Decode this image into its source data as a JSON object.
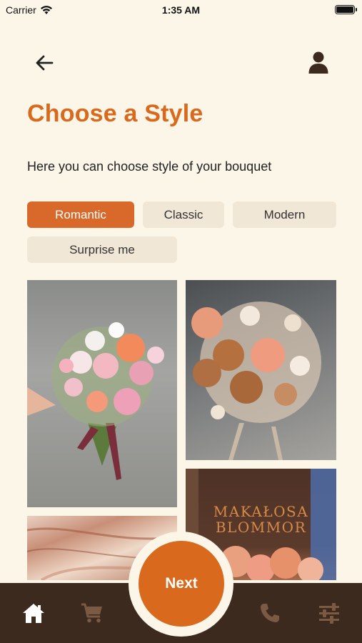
{
  "status_bar": {
    "carrier": "Carrier",
    "time": "1:35 AM",
    "battery_level": 1.0
  },
  "header": {
    "back_icon": "arrow-left-icon",
    "profile_icon": "user-icon"
  },
  "title": "Choose a Style",
  "subtitle": "Here you can choose style of your bouquet",
  "styles": {
    "romantic": "Romantic",
    "classic": "Classic",
    "modern": "Modern",
    "surprise": "Surprise me",
    "selected": "Romantic"
  },
  "gallery": {
    "sign_line1": "MAKAŁOSA",
    "sign_line2": "BLOMMOR"
  },
  "next_label": "Next",
  "bottom_nav": {
    "home_icon": "home-icon",
    "cart_icon": "cart-icon",
    "phone_icon": "phone-icon",
    "filters_icon": "sliders-icon"
  },
  "colors": {
    "accent": "#d8691d",
    "background": "#fcf6e9",
    "nav_bar": "#3c2a1f",
    "chip": "#f0e7d6"
  }
}
